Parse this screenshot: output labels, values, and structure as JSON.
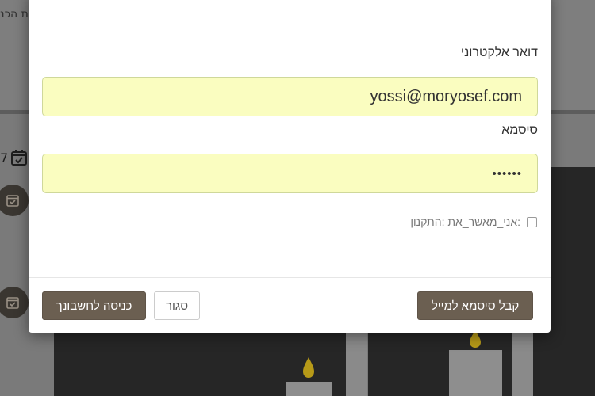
{
  "background": {
    "partial_text": "ת הכנ",
    "date_fragment": "7",
    "icons": [
      "calendar-check-icon",
      "calendar-check-icon",
      "calendar-check-icon"
    ]
  },
  "login_modal": {
    "email": {
      "label": "דואר אלקטרוני",
      "value": "yossi@moryosef.com"
    },
    "password": {
      "label": "סיסמא",
      "value": "••••••"
    },
    "agree": {
      "label": ":אני_מאשר_את :התקנון",
      "checked": false
    },
    "buttons": {
      "login": "כניסה לחשבונך",
      "close": "סגור",
      "email_password": "קבל סיסמא למייל"
    }
  },
  "colors": {
    "accent": "#6b5f51",
    "autofill": "#fafdc0"
  }
}
